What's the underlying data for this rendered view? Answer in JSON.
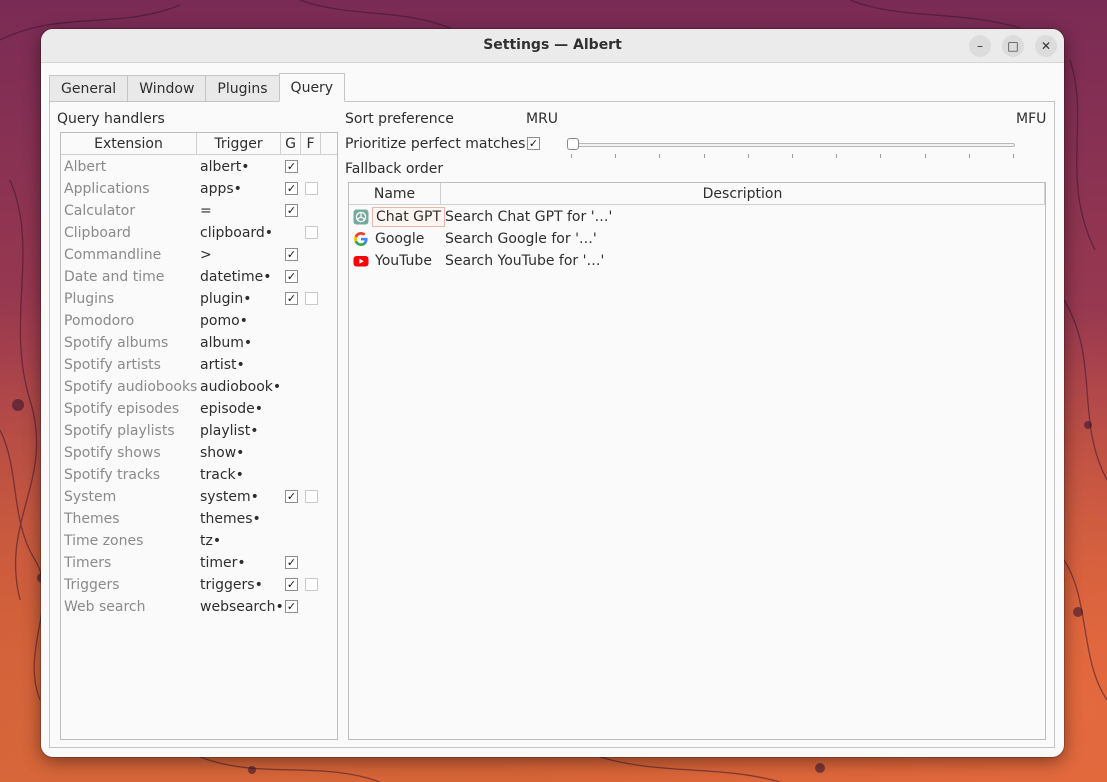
{
  "window": {
    "title": "Settings — Albert"
  },
  "window_controls": {
    "minimize": "–",
    "maximize": "□",
    "close": "✕"
  },
  "tabs": [
    {
      "label": "General",
      "active": false
    },
    {
      "label": "Window",
      "active": false
    },
    {
      "label": "Plugins",
      "active": false
    },
    {
      "label": "Query",
      "active": true
    }
  ],
  "query_handlers": {
    "title": "Query handlers",
    "columns": {
      "extension": "Extension",
      "trigger": "Trigger",
      "g": "G",
      "f": "F"
    },
    "rows": [
      {
        "extension": "Albert",
        "trigger": "albert•",
        "g": true,
        "f": null
      },
      {
        "extension": "Applications",
        "trigger": "apps•",
        "g": true,
        "f": false
      },
      {
        "extension": "Calculator",
        "trigger": "=",
        "g": true,
        "f": null
      },
      {
        "extension": "Clipboard",
        "trigger": "clipboard•",
        "g": null,
        "f": false
      },
      {
        "extension": "Commandline",
        "trigger": ">",
        "g": true,
        "f": null
      },
      {
        "extension": "Date and time",
        "trigger": "datetime•",
        "g": true,
        "f": null
      },
      {
        "extension": "Plugins",
        "trigger": "plugin•",
        "g": true,
        "f": false
      },
      {
        "extension": "Pomodoro",
        "trigger": "pomo•",
        "g": null,
        "f": null
      },
      {
        "extension": "Spotify albums",
        "trigger": "album•",
        "g": null,
        "f": null
      },
      {
        "extension": "Spotify artists",
        "trigger": "artist•",
        "g": null,
        "f": null
      },
      {
        "extension": "Spotify audiobooks",
        "trigger": "audiobook•",
        "g": null,
        "f": null
      },
      {
        "extension": "Spotify episodes",
        "trigger": "episode•",
        "g": null,
        "f": null
      },
      {
        "extension": "Spotify playlists",
        "trigger": "playlist•",
        "g": null,
        "f": null
      },
      {
        "extension": "Spotify shows",
        "trigger": "show•",
        "g": null,
        "f": null
      },
      {
        "extension": "Spotify tracks",
        "trigger": "track•",
        "g": null,
        "f": null
      },
      {
        "extension": "System",
        "trigger": "system•",
        "g": true,
        "f": false
      },
      {
        "extension": "Themes",
        "trigger": "themes•",
        "g": null,
        "f": null
      },
      {
        "extension": "Time zones",
        "trigger": "tz•",
        "g": null,
        "f": null
      },
      {
        "extension": "Timers",
        "trigger": "timer•",
        "g": true,
        "f": null
      },
      {
        "extension": "Triggers",
        "trigger": "triggers•",
        "g": true,
        "f": false
      },
      {
        "extension": "Web search",
        "trigger": "websearch•",
        "g": true,
        "f": null
      }
    ]
  },
  "sort_preference": {
    "label": "Sort preference",
    "min_label": "MRU",
    "max_label": "MFU",
    "value_fraction": 0
  },
  "prioritize": {
    "label": "Prioritize perfect matches",
    "checked": true
  },
  "fallback": {
    "title": "Fallback order",
    "columns": {
      "name": "Name",
      "description": "Description"
    },
    "rows": [
      {
        "icon": "chatgpt-icon",
        "name": "Chat GPT",
        "description": "Search Chat GPT for '…'",
        "selected": true
      },
      {
        "icon": "google-icon",
        "name": "Google",
        "description": "Search Google for '…'",
        "selected": false
      },
      {
        "icon": "youtube-icon",
        "name": "YouTube",
        "description": "Search YouTube for '…'",
        "selected": false
      }
    ]
  },
  "colors": {
    "youtube_red": "#ff0000",
    "chatgpt_green": "#74aa9c",
    "selection_border": "#e7b8a6"
  }
}
